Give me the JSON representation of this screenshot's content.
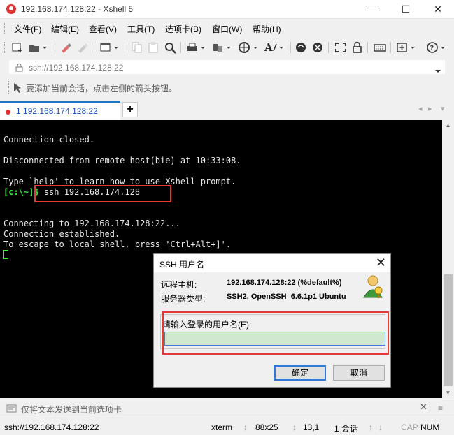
{
  "window": {
    "title": "192.168.174.128:22 - Xshell 5",
    "controls": {
      "minimize": "—",
      "maximize": "☐",
      "close": "✕"
    }
  },
  "menu": {
    "items": [
      "文件(F)",
      "编辑(E)",
      "查看(V)",
      "工具(T)",
      "选项卡(B)",
      "窗口(W)",
      "帮助(H)"
    ]
  },
  "toolbar": {
    "icons": [
      "new-session-icon",
      "open-folder-icon",
      "reconnect-icon",
      "disconnect-icon",
      "properties-icon",
      "copy-icon",
      "paste-icon",
      "find-icon",
      "print-icon",
      "transfer-icon",
      "globe-icon",
      "font-icon",
      "xftp-icon",
      "xshell-icon",
      "fullscreen-icon",
      "lock-icon",
      "keyboard-icon",
      "add-icon",
      "help-icon"
    ]
  },
  "address": {
    "text": "ssh://192.168.174.128:22"
  },
  "hint": {
    "text": "要添加当前会话，点击左侧的箭头按钮。"
  },
  "tabs": {
    "active_number": "1",
    "active_label": "192.168.174.128:22",
    "add_label": "+",
    "nav_prev": "◂",
    "nav_next": "▸"
  },
  "terminal": {
    "lines": {
      "l1": "Connection closed.",
      "l2": "Disconnected from remote host(bie) at 10:33:08.",
      "l3": "Type `help' to learn how to use Xshell prompt.",
      "prompt": "[c:\\~]$",
      "command": " ssh 192.168.174.128",
      "l5": "Connecting to 192.168.174.128:22...",
      "l6": "Connection established.",
      "l7": "To escape to local shell, press 'Ctrl+Alt+]'."
    }
  },
  "dialog": {
    "title": "SSH 用户名",
    "close": "✕",
    "remote_host_label": "远程主机:",
    "remote_host_value": "192.168.174.128:22 (%default%)",
    "server_type_label": "服务器类型:",
    "server_type_value": "SSH2, OpenSSH_6.6.1p1 Ubuntu",
    "input_label": "请输入登录的用户名(E):",
    "input_value": "",
    "ok_label": "确定",
    "cancel_label": "取消"
  },
  "sendbar": {
    "text": "仅将文本发送到当前选项卡",
    "close": "✕"
  },
  "status": {
    "address": "ssh://192.168.174.128:22",
    "terminal_type": "xterm",
    "size": "88x25",
    "cursor": "13,1",
    "sessions": "1 会话",
    "cap": "CAP",
    "num": "NUM"
  },
  "colors": {
    "accent": "#1a74c9",
    "terminal_bg": "#000000",
    "prompt_green": "#33ee33",
    "highlight_red": "#e53935"
  }
}
